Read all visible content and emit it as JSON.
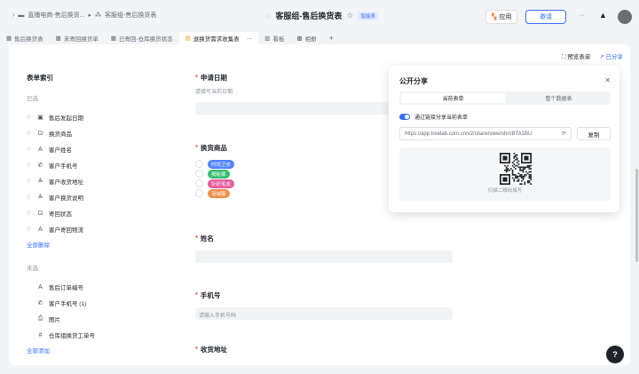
{
  "breadcrumb": [
    "直播电商-售后换货...",
    "客服组-售后换货表"
  ],
  "title": "客服组-售后换货表",
  "title_badge": "智能表",
  "header": {
    "app_label": "应用",
    "invite_label": "邀请",
    "more": "···"
  },
  "tabs": [
    {
      "label": "售后换货表"
    },
    {
      "label": "未寄回换货单"
    },
    {
      "label": "已寄回-仓库换货状态"
    },
    {
      "label": "退换货需求收集表"
    },
    {
      "label": "···"
    },
    {
      "label": "看板"
    },
    {
      "label": "相册"
    },
    {
      "label": "+"
    }
  ],
  "toolbar": {
    "preview": "预览表单",
    "share": "已分享"
  },
  "index": {
    "title": "表单索引",
    "selected_label": "已选",
    "selected": [
      {
        "label": "售后发起日期",
        "icon": "calendar-icon",
        "glyph": "▣"
      },
      {
        "label": "换货商品",
        "icon": "select-icon",
        "glyph": "⊡"
      },
      {
        "label": "客户姓名",
        "icon": "text-icon",
        "glyph": "A"
      },
      {
        "label": "客户手机号",
        "icon": "phone-icon",
        "glyph": "✆"
      },
      {
        "label": "客户收货地址",
        "icon": "long-text-icon",
        "glyph": "≜"
      },
      {
        "label": "客户换货说明",
        "icon": "long-text-icon",
        "glyph": "≜"
      },
      {
        "label": "寄回状态",
        "icon": "select-icon",
        "glyph": "⊡"
      },
      {
        "label": "客户寄回物流",
        "icon": "text-icon",
        "glyph": "A"
      }
    ],
    "remove_all": "全部删除",
    "unselected_label": "未选",
    "unselected": [
      {
        "label": "售后订单编号",
        "icon": "text-icon",
        "glyph": "A"
      },
      {
        "label": "客户手机号 (1)",
        "icon": "phone-icon",
        "glyph": "✆"
      },
      {
        "label": "图片",
        "icon": "attachment-icon",
        "glyph": "⎙"
      },
      {
        "label": "仓库组换货工单号",
        "icon": "number-icon",
        "glyph": "#"
      }
    ],
    "add_all": "全部添加"
  },
  "form": {
    "date": {
      "label": "申请日期",
      "hint": "请填写当前日期"
    },
    "goods": {
      "label": "换货商品",
      "options": [
        {
          "label": "时尚卫衣",
          "color": "#4e83fd"
        },
        {
          "label": "揭秘裤",
          "color": "#35bd6e"
        },
        {
          "label": "针织毛衣",
          "color": "#e85d9d"
        },
        {
          "label": "羽绒服",
          "color": "#f08d49"
        }
      ]
    },
    "name": {
      "label": "姓名"
    },
    "phone": {
      "label": "手机号",
      "placeholder": "请输入手机号码"
    },
    "address": {
      "label": "收货地址"
    }
  },
  "share": {
    "title": "公开分享",
    "seg_current": "当前表单",
    "seg_all": "整个数据表",
    "toggle_label": "通过链接分享当前表单",
    "url": "https://app.treelab.com.cn/v2/share/view/shrcBTA1BU",
    "copy": "复制",
    "qr_caption": "扫描二维码填写"
  },
  "help": "?"
}
